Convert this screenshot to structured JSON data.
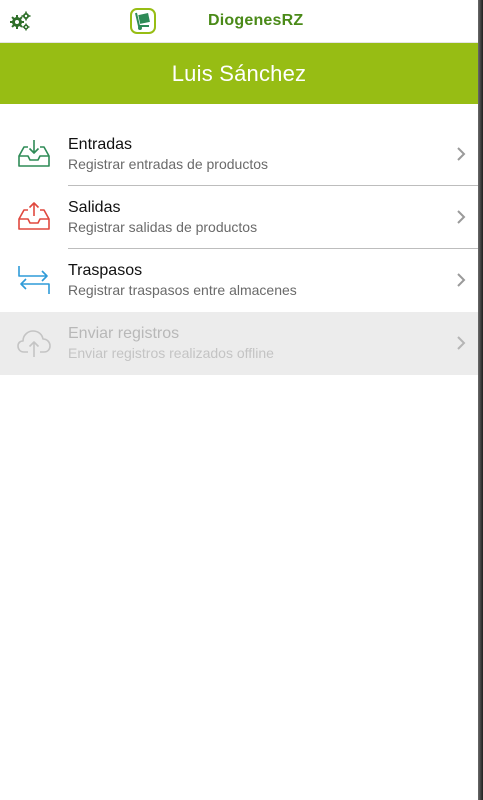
{
  "app": {
    "title": "DiogenesRZ",
    "settings_icon": "gears-icon",
    "logo_icon": "dolly-icon"
  },
  "header": {
    "user_name": "Luis Sánchez",
    "color": "#97bd14"
  },
  "menu": {
    "items": [
      {
        "title": "Entradas",
        "subtitle": "Registrar entradas de productos",
        "icon": "inbox-download-icon",
        "color": "#2e8b57",
        "enabled": true
      },
      {
        "title": "Salidas",
        "subtitle": "Registrar salidas de productos",
        "icon": "inbox-upload-icon",
        "color": "#e0483e",
        "enabled": true
      },
      {
        "title": "Traspasos",
        "subtitle": "Registrar traspasos entre almacenes",
        "icon": "transfer-arrows-icon",
        "color": "#2f9bd8",
        "enabled": true
      },
      {
        "title": "Enviar registros",
        "subtitle": "Enviar registros realizados offline",
        "icon": "cloud-upload-icon",
        "color": "#c4c4c4",
        "enabled": false
      }
    ]
  }
}
